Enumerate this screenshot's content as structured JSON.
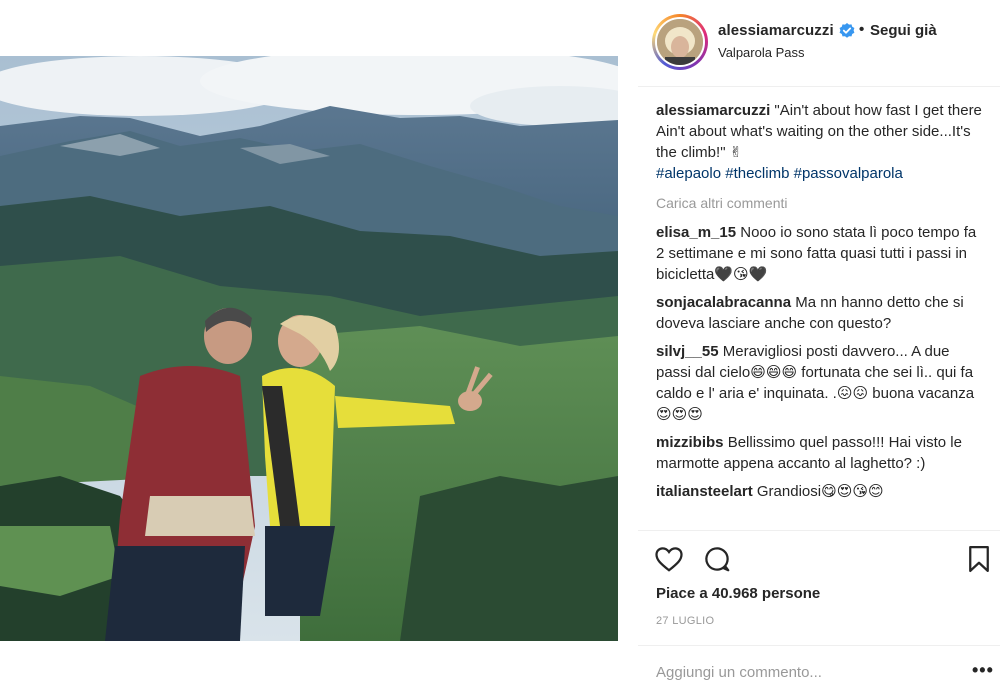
{
  "post": {
    "username": "alessiamarcuzzi",
    "separator": "•",
    "follow_label": "Segui già",
    "location": "Valparola Pass",
    "photo_alt": ""
  },
  "caption": {
    "username": "alessiamarcuzzi",
    "text": "\"Ain't about how fast I get there Ain't about what's waiting on the other side...It's the climb!\" ✌",
    "hashtags": [
      "#alepaolo",
      "#theclimb",
      "#passovalparola"
    ]
  },
  "load_more": "Carica altri commenti",
  "comments": [
    {
      "username": "elisa_m_15",
      "text": "Nooo io sono stata lì poco tempo fa 2 settimane e mi sono fatta quasi tutti i passi in bicicletta🖤😘🖤"
    },
    {
      "username": "sonjacalabracanna",
      "text": "Ma nn hanno detto che si doveva lasciare anche con questo?"
    },
    {
      "username": "silvj__55",
      "text": "Meravigliosi posti davvero... A due passi dal cielo😄😄😄 fortunata che sei lì.. qui fa caldo e l' aria e' inquinata. .😖😖 buona vacanza 😍😍😍"
    },
    {
      "username": "mizzibibs",
      "text": "Bellissimo quel passo!!! Hai visto le marmotte appena accanto al laghetto? :)"
    },
    {
      "username": "italiansteelart",
      "text": "Grandiosi😋😍😘😊"
    }
  ],
  "likes": "Piace a 40.968 persone",
  "date": "27 LUGLIO",
  "add_comment_placeholder": "Aggiungi un commento...",
  "options_label": "•••",
  "icons": {
    "like": "heart-icon",
    "comment": "comment-bubble-icon",
    "save": "bookmark-icon",
    "verified": "verified-badge-icon"
  },
  "colors": {
    "hashtag": "#003569",
    "verified": "#3897f0",
    "muted": "#999999"
  }
}
